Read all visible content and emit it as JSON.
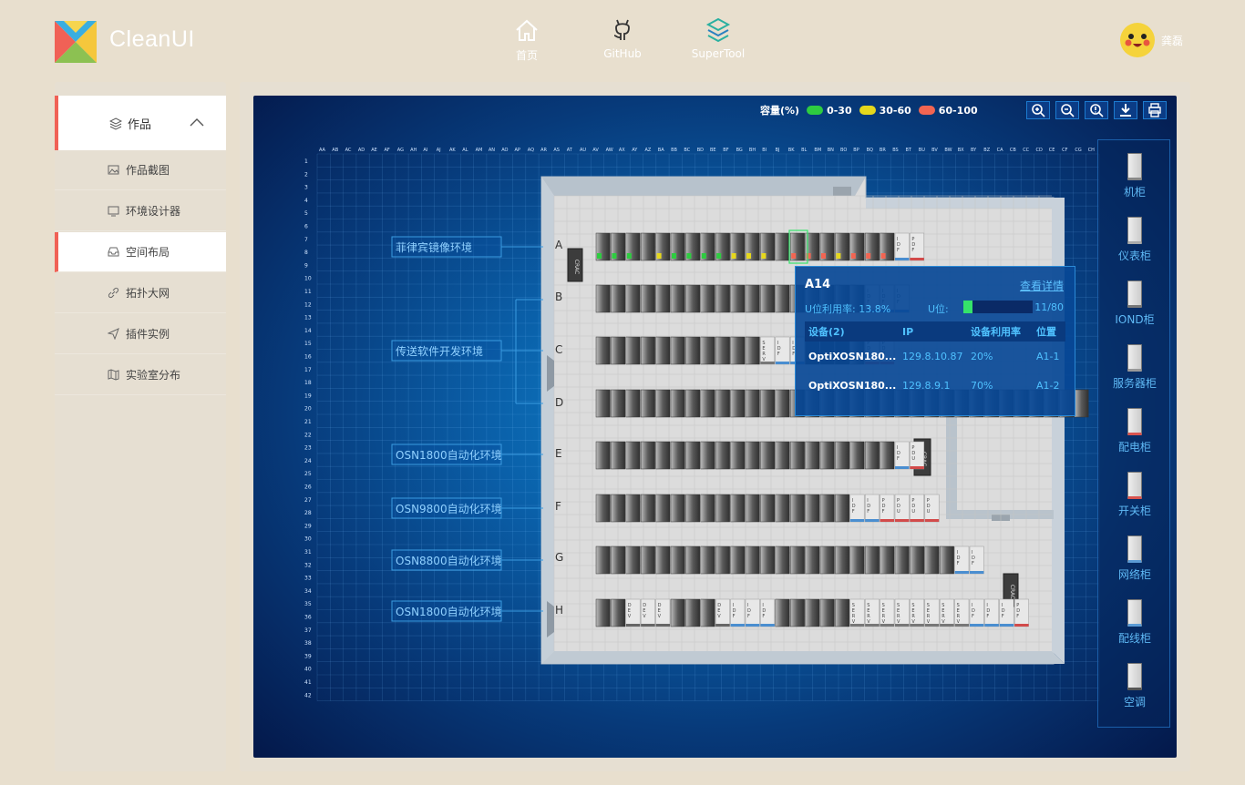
{
  "app": {
    "name": "CleanUI"
  },
  "nav": [
    {
      "label": "首页",
      "icon": "home-icon"
    },
    {
      "label": "GitHub",
      "icon": "github-icon"
    },
    {
      "label": "SuperTool",
      "icon": "supertool-icon"
    }
  ],
  "user": {
    "name": "龚磊"
  },
  "sidebar": {
    "group": "作品",
    "items": [
      {
        "label": "作品截图",
        "icon": "image-icon"
      },
      {
        "label": "环境设计器",
        "icon": "monitor-icon"
      },
      {
        "label": "空间布局",
        "icon": "inbox-icon",
        "active": true
      },
      {
        "label": "拓扑大网",
        "icon": "link-icon"
      },
      {
        "label": "插件实例",
        "icon": "send-icon"
      },
      {
        "label": "实验室分布",
        "icon": "map-icon"
      }
    ]
  },
  "legend": {
    "title": "容量(%)",
    "items": [
      {
        "label": "0-30",
        "color": "#2ecc40"
      },
      {
        "label": "30-60",
        "color": "#e6d81c"
      },
      {
        "label": "60-100",
        "color": "#f26552"
      }
    ]
  },
  "tools": [
    "zoom-in-icon",
    "zoom-out-icon",
    "zoom-reset-icon",
    "download-icon",
    "print-icon"
  ],
  "grid": {
    "cols": [
      "AA",
      "AB",
      "AC",
      "AD",
      "AE",
      "AF",
      "AG",
      "AH",
      "AI",
      "AJ",
      "AK",
      "AL",
      "AM",
      "AN",
      "AO",
      "AP",
      "AQ",
      "AR",
      "AS",
      "AT",
      "AU",
      "AV",
      "AW",
      "AX",
      "AY",
      "AZ",
      "BA",
      "BB",
      "BC",
      "BD",
      "BE",
      "BF",
      "BG",
      "BH",
      "BI",
      "BJ",
      "BK",
      "BL",
      "BM",
      "BN",
      "BO",
      "BP",
      "BQ",
      "BR",
      "BS",
      "BT",
      "BU",
      "BV",
      "BW",
      "BX",
      "BY",
      "BZ",
      "CA",
      "CB",
      "CC",
      "CD",
      "CE",
      "CF",
      "CG",
      "CH"
    ],
    "rows": [
      "1",
      "2",
      "3",
      "4",
      "5",
      "6",
      "7",
      "8",
      "9",
      "10",
      "11",
      "12",
      "13",
      "14",
      "15",
      "16",
      "17",
      "18",
      "19",
      "20",
      "21",
      "22",
      "23",
      "24",
      "25",
      "26",
      "27",
      "28",
      "29",
      "30",
      "31",
      "32",
      "33",
      "34",
      "35",
      "36",
      "37",
      "38",
      "39",
      "40",
      "41",
      "42"
    ]
  },
  "env_labels": [
    "菲律宾镜像环境",
    "传送软件开发环境",
    "OSN1800自动化环境",
    "OSN9800自动化环境",
    "OSN8800自动化环境",
    "OSN1800自动化环境"
  ],
  "row_letters": [
    "A",
    "B",
    "C",
    "D",
    "E",
    "F",
    "G",
    "H"
  ],
  "crac_label": "CRAC",
  "rack_glyphs": {
    "IDF": "I D F",
    "PDF": "P D F",
    "PDU": "P D U",
    "SERV": "S E R V",
    "DEV": "D E V"
  },
  "tooltip": {
    "title": "A14",
    "detail": "查看详情",
    "u_util_label": "U位利用率:",
    "u_util_value": "13.8%",
    "u_label": "U位:",
    "u_fill": 0.1375,
    "u_count": "11/80",
    "headers": [
      "设备(2)",
      "IP",
      "设备利用率",
      "位置"
    ],
    "rows": [
      [
        "OptiXOSN180...",
        "129.8.10.87",
        "20%",
        "A1-1"
      ],
      [
        "OptiXOSN180...",
        "129.8.9.1",
        "70%",
        "A1-2"
      ]
    ]
  },
  "cabinet_types": [
    {
      "label": "机柜",
      "color": "#888888"
    },
    {
      "label": "仪表柜",
      "color": "#aaaaaa"
    },
    {
      "label": "IOND柜",
      "color": "#777777"
    },
    {
      "label": "服务器柜",
      "color": "#999999"
    },
    {
      "label": "配电柜",
      "color": "#d9534f"
    },
    {
      "label": "开关柜",
      "color": "#d9534f"
    },
    {
      "label": "网络柜",
      "color": "#5b9bd5"
    },
    {
      "label": "配线柜",
      "color": "#5b9bd5"
    },
    {
      "label": "空调",
      "color": "#555555"
    }
  ]
}
